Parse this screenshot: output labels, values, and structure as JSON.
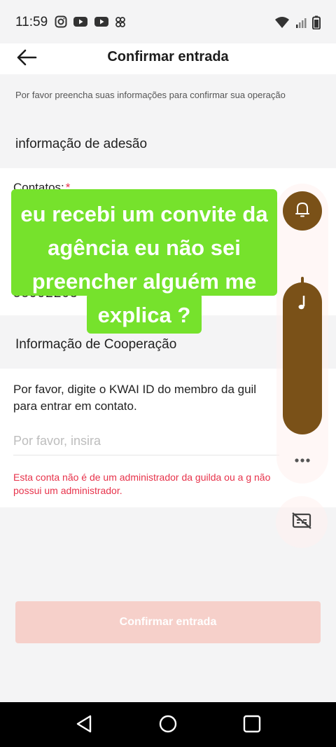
{
  "status_bar": {
    "time": "11:59",
    "left_icons": [
      "instagram-icon",
      "youtube-icon",
      "youtube-icon",
      "app-notification-icon"
    ],
    "right_icons": [
      "wifi-icon",
      "signal-icon",
      "battery-icon"
    ]
  },
  "header": {
    "back_icon": "arrow-left-icon",
    "title": "Confirmar entrada"
  },
  "subtitle": "Por favor preencha suas informações para confirmar sua operação",
  "membership": {
    "section_title": "informação de adesão",
    "contacts_label": "Contatos:",
    "required_mark": "*",
    "contacts_value": "55992203"
  },
  "cooperation": {
    "section_title": "Informação de Cooperação",
    "description": "Por favor, digite o KWAI ID do membro da guil para entrar em contato.",
    "input_placeholder": "Por favor, insira",
    "error_text": "Esta conta não é de um administrador da guilda ou a g não possui um administrador."
  },
  "confirm_button": "Confirmar entrada",
  "caption_overlay": "eu recebi um convite da agência eu não sei preencher alguém me explica ?",
  "floating_panel": {
    "icons": [
      "bell-icon",
      "music-note-icon",
      "more-dots-icon",
      "captions-off-icon"
    ]
  },
  "nav_bar": {
    "icons": [
      "nav-back-icon",
      "nav-home-icon",
      "nav-recents-icon"
    ]
  },
  "colors": {
    "accent_red": "#e7334b",
    "button_disabled": "#f6d0ca",
    "caption_green": "#76e22c",
    "panel_brown": "#7a5118"
  }
}
